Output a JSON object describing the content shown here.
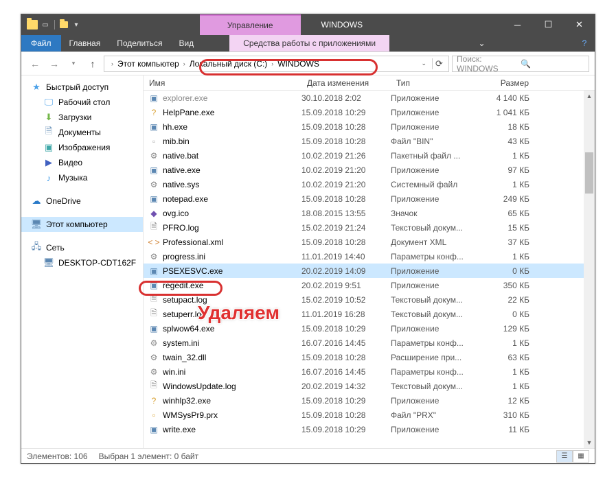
{
  "title": {
    "manage": "Управление",
    "folder": "WINDOWS"
  },
  "ribbon": {
    "file": "Файл",
    "tabs": [
      "Главная",
      "Поделиться",
      "Вид"
    ],
    "contextual": "Средства работы с приложениями"
  },
  "breadcrumb": {
    "this_pc": "Этот компьютер",
    "drive": "Локальный диск (C:)",
    "folder": "WINDOWS"
  },
  "search": {
    "placeholder": "Поиск: WINDOWS"
  },
  "nav": {
    "quick": "Быстрый доступ",
    "desktop": "Рабочий стол",
    "downloads": "Загрузки",
    "documents": "Документы",
    "pictures": "Изображения",
    "videos": "Видео",
    "music": "Музыка",
    "onedrive": "OneDrive",
    "this_pc": "Этот компьютер",
    "network": "Сеть",
    "host": "DESKTOP-CDT162F"
  },
  "columns": {
    "name": "Имя",
    "date": "Дата изменения",
    "type": "Тип",
    "size": "Размер"
  },
  "files": [
    {
      "icon": "exe",
      "name": "explorer.exe",
      "date": "30.10.2018 2:02",
      "type": "Приложение",
      "size": "4 140 КБ",
      "cut": true
    },
    {
      "icon": "help",
      "name": "HelpPane.exe",
      "date": "15.09.2018 10:29",
      "type": "Приложение",
      "size": "1 041 КБ"
    },
    {
      "icon": "exe",
      "name": "hh.exe",
      "date": "15.09.2018 10:28",
      "type": "Приложение",
      "size": "18 КБ"
    },
    {
      "icon": "bin",
      "name": "mib.bin",
      "date": "15.09.2018 10:28",
      "type": "Файл \"BIN\"",
      "size": "43 КБ"
    },
    {
      "icon": "bat",
      "name": "native.bat",
      "date": "10.02.2019 21:26",
      "type": "Пакетный файл ...",
      "size": "1 КБ"
    },
    {
      "icon": "exe",
      "name": "native.exe",
      "date": "10.02.2019 21:20",
      "type": "Приложение",
      "size": "97 КБ"
    },
    {
      "icon": "sys",
      "name": "native.sys",
      "date": "10.02.2019 21:20",
      "type": "Системный файл",
      "size": "1 КБ"
    },
    {
      "icon": "exe",
      "name": "notepad.exe",
      "date": "15.09.2018 10:28",
      "type": "Приложение",
      "size": "249 КБ"
    },
    {
      "icon": "ico",
      "name": "ovg.ico",
      "date": "18.08.2015 13:55",
      "type": "Значок",
      "size": "65 КБ"
    },
    {
      "icon": "txt",
      "name": "PFRO.log",
      "date": "15.02.2019 21:24",
      "type": "Текстовый докум...",
      "size": "15 КБ"
    },
    {
      "icon": "xml",
      "name": "Professional.xml",
      "date": "15.09.2018 10:28",
      "type": "Документ XML",
      "size": "37 КБ"
    },
    {
      "icon": "ini",
      "name": "progress.ini",
      "date": "11.01.2019 14:40",
      "type": "Параметры конф...",
      "size": "1 КБ"
    },
    {
      "icon": "exe",
      "name": "PSEXESVC.exe",
      "date": "20.02.2019 14:09",
      "type": "Приложение",
      "size": "0 КБ",
      "selected": true
    },
    {
      "icon": "exe",
      "name": "regedit.exe",
      "date": "20.02.2019 9:51",
      "type": "Приложение",
      "size": "350 КБ"
    },
    {
      "icon": "txt",
      "name": "setupact.log",
      "date": "15.02.2019 10:52",
      "type": "Текстовый докум...",
      "size": "22 КБ"
    },
    {
      "icon": "txt",
      "name": "setuperr.log",
      "date": "11.01.2019 16:28",
      "type": "Текстовый докум...",
      "size": "0 КБ"
    },
    {
      "icon": "exe",
      "name": "splwow64.exe",
      "date": "15.09.2018 10:29",
      "type": "Приложение",
      "size": "129 КБ"
    },
    {
      "icon": "ini",
      "name": "system.ini",
      "date": "16.07.2016 14:45",
      "type": "Параметры конф...",
      "size": "1 КБ"
    },
    {
      "icon": "dll",
      "name": "twain_32.dll",
      "date": "15.09.2018 10:28",
      "type": "Расширение при...",
      "size": "63 КБ"
    },
    {
      "icon": "ini",
      "name": "win.ini",
      "date": "16.07.2016 14:45",
      "type": "Параметры конф...",
      "size": "1 КБ"
    },
    {
      "icon": "txt",
      "name": "WindowsUpdate.log",
      "date": "20.02.2019 14:32",
      "type": "Текстовый докум...",
      "size": "1 КБ"
    },
    {
      "icon": "help",
      "name": "winhlp32.exe",
      "date": "15.09.2018 10:29",
      "type": "Приложение",
      "size": "12 КБ"
    },
    {
      "icon": "prx",
      "name": "WMSysPr9.prx",
      "date": "15.09.2018 10:28",
      "type": "Файл \"PRX\"",
      "size": "310 КБ"
    },
    {
      "icon": "exe",
      "name": "write.exe",
      "date": "15.09.2018 10:29",
      "type": "Приложение",
      "size": "11 КБ"
    }
  ],
  "status": {
    "count": "Элементов: 106",
    "selected": "Выбран 1 элемент: 0 байт"
  },
  "annotation": "Удаляем"
}
